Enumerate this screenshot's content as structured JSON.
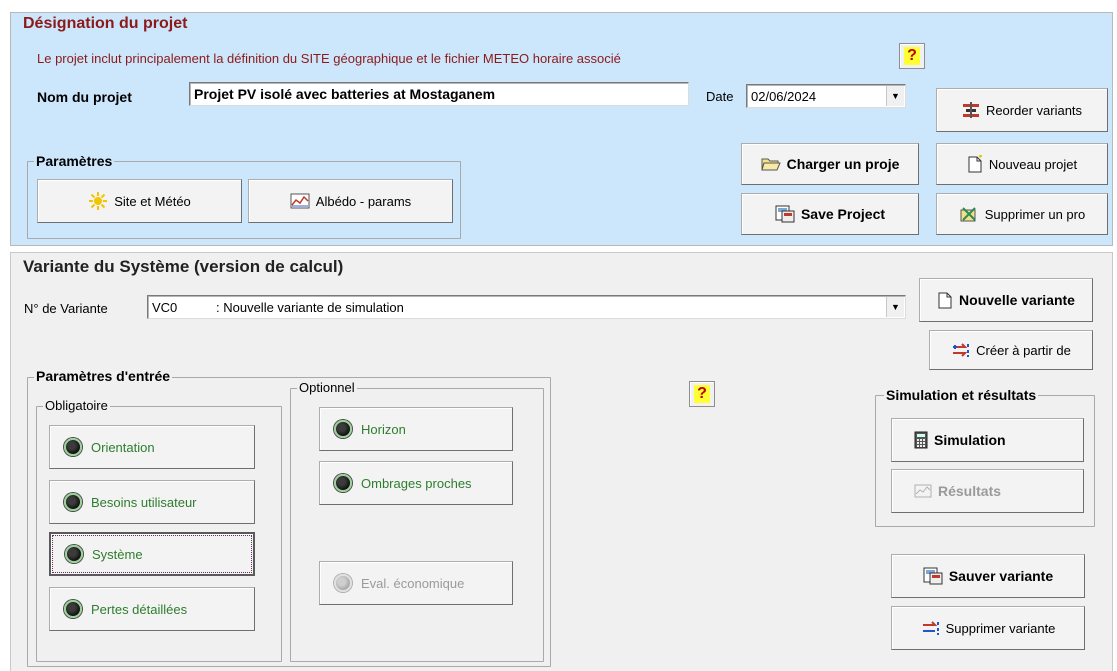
{
  "project": {
    "section_title": "Désignation du projet",
    "description": "Le projet inclut principalement la définition du SITE géographique et le fichier METEO horaire associé",
    "name_label": "Nom du projet",
    "name_value": "Projet PV isolé avec batteries at Mostaganem",
    "date_label": "Date",
    "date_value": "02/06/2024",
    "help": "?",
    "reorder_variants": "Reorder variants",
    "load_project": "Charger un proje",
    "new_project": "Nouveau projet",
    "save_project": "Save Project",
    "delete_project": "Supprimer un pro",
    "params_title": "Paramètres",
    "site_meteo": "Site et Météo",
    "albedo": "Albédo - params"
  },
  "variant": {
    "section_title": "Variante du Système (version de calcul)",
    "number_label": "N° de Variante",
    "number_value": "VC0",
    "description_value": ": Nouvelle variante de simulation",
    "new_variant": "Nouvelle variante",
    "create_from": "Créer à partir de",
    "input_params_title": "Paramètres d'entrée",
    "mandatory_title": "Obligatoire",
    "optional_title": "Optionnel",
    "orientation": "Orientation",
    "user_needs": "Besoins utilisateur",
    "system": "Système",
    "detailed_losses": "Pertes détaillées",
    "horizon": "Horizon",
    "near_shadings": "Ombrages proches",
    "economic_eval": "Eval. économique",
    "help": "?",
    "sim_results_title": "Simulation et résultats",
    "simulation": "Simulation",
    "results": "Résultats",
    "save_variant": "Sauver variante",
    "delete_variant": "Supprimer variante"
  },
  "colors": {
    "top_panel": "#cce6fb",
    "bottom_panel": "#f0f0f0",
    "title_red": "#8b1a1a",
    "green_text": "#2e7d2e",
    "help_yellow": "#ffff33"
  }
}
